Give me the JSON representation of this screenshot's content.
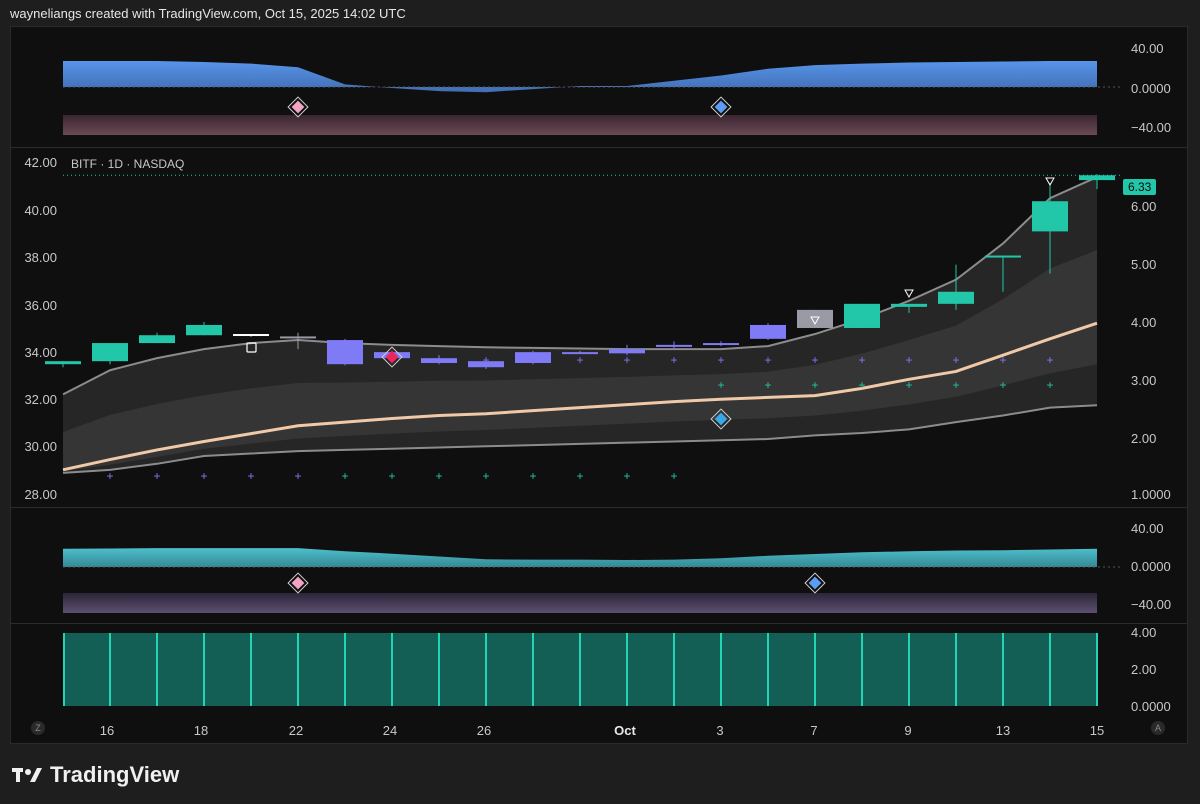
{
  "header": {
    "credit": "wayneliangs created with TradingView.com, Oct 15, 2025 14:02 UTC"
  },
  "main_chart": {
    "symbol": "BITF · 1D · NASDAQ",
    "last_price": "6.33",
    "left_axis": [
      "42.00",
      "40.00",
      "38.00",
      "36.00",
      "34.00",
      "32.00",
      "30.00",
      "28.00"
    ],
    "right_axis": [
      "6.00",
      "5.00",
      "4.00",
      "3.00",
      "2.00",
      "1.0000"
    ]
  },
  "top_osc": {
    "right_axis": [
      "40.00",
      "0.0000",
      "−40.00"
    ]
  },
  "mid_osc": {
    "right_axis": [
      "40.00",
      "0.0000",
      "−40.00"
    ]
  },
  "volume": {
    "right_axis": [
      "4.00",
      "2.00",
      "0.0000"
    ]
  },
  "time_axis": {
    "labels": [
      "16",
      "18",
      "22",
      "24",
      "26",
      "Oct",
      "3",
      "7",
      "9",
      "13",
      "15"
    ],
    "corner_left": "Z",
    "corner_right": "A"
  },
  "footer": {
    "brand": "TradingView"
  },
  "colors": {
    "bull": "#22c7a9",
    "bear": "#7f7af5",
    "ma": "#f0c9a8",
    "band": "#8c8c8c",
    "osc_top": "#5b9cf6",
    "osc_mid": "#4fc3d1",
    "volume": "#135e55"
  },
  "chart_data": {
    "type": "candlestick",
    "dates": [
      "15",
      "16",
      "17",
      "18",
      "19",
      "22",
      "23",
      "24",
      "25",
      "26",
      "29",
      "30",
      "Oct",
      "2",
      "3",
      "6",
      "7",
      "8",
      "9",
      "10",
      "13",
      "14",
      "15"
    ],
    "candles": [
      {
        "o": 3.2,
        "h": 3.25,
        "l": 3.15,
        "c": 3.25,
        "dir": "bull"
      },
      {
        "o": 3.25,
        "h": 3.55,
        "l": 3.2,
        "c": 3.55,
        "dir": "bull"
      },
      {
        "o": 3.55,
        "h": 3.72,
        "l": 3.55,
        "c": 3.68,
        "dir": "bull"
      },
      {
        "o": 3.68,
        "h": 3.9,
        "l": 3.68,
        "c": 3.85,
        "dir": "bull"
      },
      {
        "o": 3.7,
        "h": 3.7,
        "l": 3.65,
        "c": 3.68,
        "dir": "neutral"
      },
      {
        "o": 3.66,
        "h": 3.72,
        "l": 3.45,
        "c": 3.66,
        "dir": "neutral"
      },
      {
        "o": 3.6,
        "h": 3.62,
        "l": 3.18,
        "c": 3.2,
        "dir": "bear"
      },
      {
        "o": 3.4,
        "h": 3.42,
        "l": 3.25,
        "c": 3.3,
        "dir": "bear"
      },
      {
        "o": 3.3,
        "h": 3.35,
        "l": 3.2,
        "c": 3.22,
        "dir": "bear"
      },
      {
        "o": 3.25,
        "h": 3.28,
        "l": 3.12,
        "c": 3.15,
        "dir": "bear"
      },
      {
        "o": 3.4,
        "h": 3.42,
        "l": 3.2,
        "c": 3.22,
        "dir": "bear"
      },
      {
        "o": 3.4,
        "h": 3.42,
        "l": 3.38,
        "c": 3.4,
        "dir": "bear"
      },
      {
        "o": 3.45,
        "h": 3.52,
        "l": 3.35,
        "c": 3.38,
        "dir": "bear"
      },
      {
        "o": 3.52,
        "h": 3.58,
        "l": 3.45,
        "c": 3.5,
        "dir": "bear"
      },
      {
        "o": 3.55,
        "h": 3.58,
        "l": 3.5,
        "c": 3.54,
        "dir": "bear"
      },
      {
        "o": 3.85,
        "h": 3.88,
        "l": 3.6,
        "c": 3.62,
        "dir": "bear"
      },
      {
        "o": 3.8,
        "h": 4.1,
        "l": 3.8,
        "c": 4.1,
        "dir": "neutral"
      },
      {
        "o": 3.8,
        "h": 4.2,
        "l": 3.8,
        "c": 4.2,
        "dir": "bull"
      },
      {
        "o": 4.15,
        "h": 4.2,
        "l": 4.05,
        "c": 4.2,
        "dir": "bull"
      },
      {
        "o": 4.2,
        "h": 4.85,
        "l": 4.1,
        "c": 4.4,
        "dir": "bull"
      },
      {
        "o": 5.0,
        "h": 5.0,
        "l": 4.4,
        "c": 5.0,
        "dir": "bull"
      },
      {
        "o": 5.4,
        "h": 6.2,
        "l": 4.7,
        "c": 5.9,
        "dir": "bull"
      },
      {
        "o": 6.25,
        "h": 6.35,
        "l": 6.1,
        "c": 6.33,
        "dir": "bull"
      }
    ],
    "ma": [
      1.45,
      1.62,
      1.78,
      1.92,
      2.05,
      2.18,
      2.24,
      2.3,
      2.35,
      2.38,
      2.43,
      2.48,
      2.53,
      2.58,
      2.62,
      2.65,
      2.68,
      2.8,
      2.95,
      3.08,
      3.35,
      3.62,
      3.88
    ],
    "band_upper": [
      2.7,
      3.1,
      3.3,
      3.45,
      3.55,
      3.6,
      3.55,
      3.52,
      3.5,
      3.48,
      3.47,
      3.46,
      3.45,
      3.45,
      3.45,
      3.5,
      3.7,
      3.95,
      4.25,
      4.6,
      5.2,
      5.95,
      6.3
    ],
    "band_lower": [
      1.4,
      1.45,
      1.55,
      1.68,
      1.72,
      1.76,
      1.78,
      1.8,
      1.82,
      1.84,
      1.86,
      1.88,
      1.9,
      1.92,
      1.94,
      1.96,
      2.02,
      2.06,
      2.12,
      2.24,
      2.35,
      2.48,
      2.52
    ],
    "y_range": [
      1.0,
      6.5
    ]
  }
}
